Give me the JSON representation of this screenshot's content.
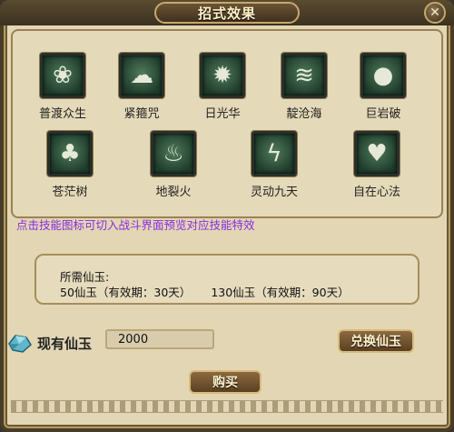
{
  "window": {
    "title": "招式效果",
    "close_symbol": "✕"
  },
  "skills_row1": [
    {
      "label": "普渡众生",
      "icon": "lotus-icon",
      "glyph": "❀"
    },
    {
      "label": "紧箍咒",
      "icon": "cloud-icon",
      "glyph": "☁"
    },
    {
      "label": "日光华",
      "icon": "sun-flower-icon",
      "glyph": "✹"
    },
    {
      "label": "靛沧海",
      "icon": "wave-icon",
      "glyph": "≋"
    },
    {
      "label": "巨岩破",
      "icon": "boulder-icon",
      "glyph": "●"
    }
  ],
  "skills_row2": [
    {
      "label": "苍茫树",
      "icon": "tree-icon",
      "glyph": "♣"
    },
    {
      "label": "地裂火",
      "icon": "fire-icon",
      "glyph": "♨"
    },
    {
      "label": "灵动九天",
      "icon": "lightning-icon",
      "glyph": "ϟ"
    },
    {
      "label": "自在心法",
      "icon": "hearts-icon",
      "glyph": "♥"
    }
  ],
  "hint": "点击技能图标可切入战斗界面预览对应技能特效",
  "cost": {
    "title": "所需仙玉:",
    "option1": "50仙玉（有效期：30天）",
    "option2": "130仙玉（有效期：90天）"
  },
  "owned": {
    "icon": "jade-gem-icon",
    "label": "现有仙玉",
    "value": "2000"
  },
  "buttons": {
    "exchange": "兑换仙玉",
    "buy": "购买"
  },
  "colors": {
    "hint": "#8a2be2",
    "panel_bg": "#e2d6b4",
    "tile_green": "#2f5a42"
  }
}
